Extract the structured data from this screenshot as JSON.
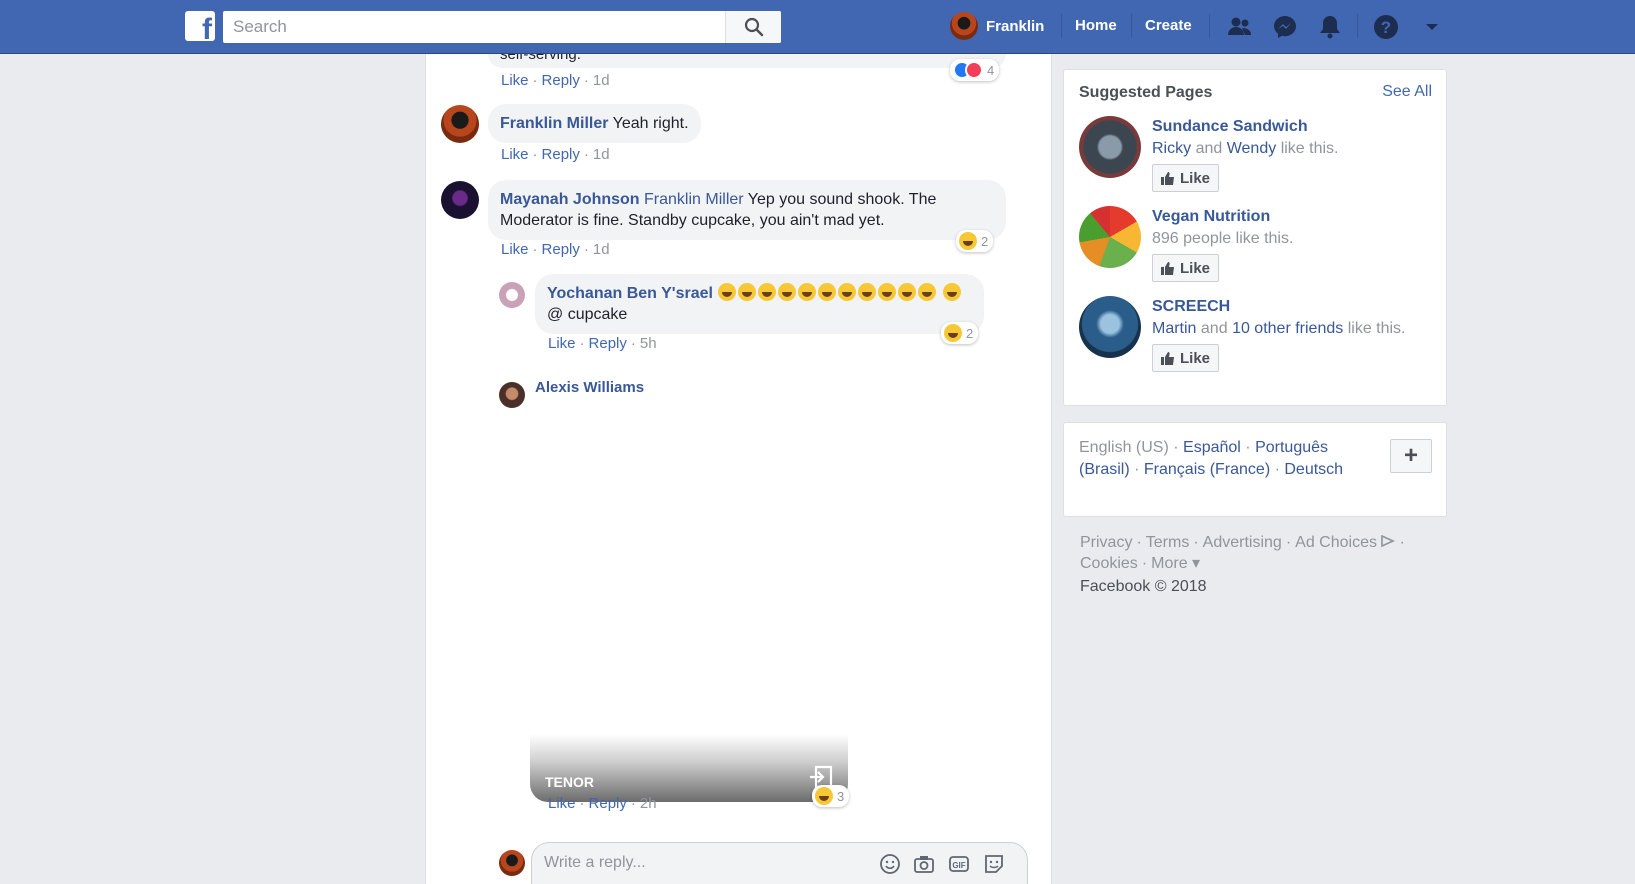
{
  "topbar": {
    "logo": "f",
    "search_placeholder": "Search",
    "user_name": "Franklin",
    "nav": [
      "Home",
      "Create"
    ],
    "icons": [
      "friends-icon",
      "messenger-icon",
      "notifications-icon",
      "help-icon",
      "chevron-down-icon"
    ]
  },
  "feed": {
    "prev_comment": {
      "text_fragment": "self-serving.",
      "actions": {
        "like": "Like",
        "reply": "Reply",
        "time": "1d"
      },
      "reaction_count": "4"
    },
    "comments": [
      {
        "author": "Franklin Miller",
        "text": "Yeah right.",
        "actions": {
          "like": "Like",
          "reply": "Reply",
          "time": "1d"
        }
      },
      {
        "author": "Mayanah Johnson",
        "tag": "Franklin Miller",
        "text": "Yep you sound shook. The Moderator is fine. Standby cupcake, you ain't mad yet.",
        "reaction_count": "2",
        "actions": {
          "like": "Like",
          "reply": "Reply",
          "time": "1d"
        }
      }
    ],
    "replies": [
      {
        "author": "Yochanan Ben Y'srael",
        "emoji_count_line1": 11,
        "text": "@ cupcake",
        "reaction_count": "2",
        "actions": {
          "like": "Like",
          "reply": "Reply",
          "time": "5h"
        }
      },
      {
        "author": "Alexis Williams",
        "gif_label": "TENOR",
        "reaction_count": "3",
        "actions": {
          "like": "Like",
          "reply": "Reply",
          "time": "2h"
        }
      }
    ],
    "reply_box_placeholder": "Write a reply..."
  },
  "sidebar": {
    "suggested_title": "Suggested Pages",
    "see_all": "See All",
    "pages": [
      {
        "name": "Sundance Sandwich",
        "friend1": "Ricky",
        "and": "and",
        "friend2": "Wendy",
        "suffix": "like this.",
        "like_label": "Like"
      },
      {
        "name": "Vegan Nutrition",
        "meta": "896 people like this.",
        "like_label": "Like"
      },
      {
        "name": "SCREECH",
        "friend1": "Martin",
        "and": "and",
        "friend2": "10 other friends",
        "suffix": "like this.",
        "like_label": "Like"
      }
    ],
    "languages": {
      "current": "English (US)",
      "options": [
        "Español",
        "Português (Brasil)",
        "Français (France)",
        "Deutsch"
      ]
    },
    "footer_links": [
      "Privacy",
      "Terms",
      "Advertising",
      "Ad Choices",
      "Cookies",
      "More"
    ],
    "copyright": "Facebook © 2018"
  },
  "colors": {
    "brand_blue": "#4267b2",
    "link_blue": "#385898",
    "bubble_grey": "#f2f3f5",
    "page_bg": "#e9ebee"
  }
}
